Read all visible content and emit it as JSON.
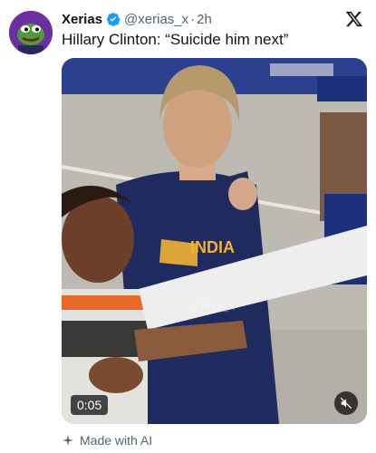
{
  "tweet": {
    "display_name": "Xerias",
    "handle": "@xerias_x",
    "time": "2h",
    "text": "Hillary Clinton: “Suicide him next”"
  },
  "media": {
    "duration": "0:05",
    "watermark": "XERIAS_X",
    "jersey_text": "INDIA"
  },
  "footer": {
    "ai_label": "Made with AI"
  },
  "icons": {
    "verified": "verified-badge-icon",
    "platform": "x-logo-icon",
    "mute": "mute-icon",
    "sparkle": "sparkle-icon"
  },
  "colors": {
    "verified_blue": "#1d9bf0",
    "text_primary": "#0f1419",
    "text_secondary": "#536471"
  }
}
